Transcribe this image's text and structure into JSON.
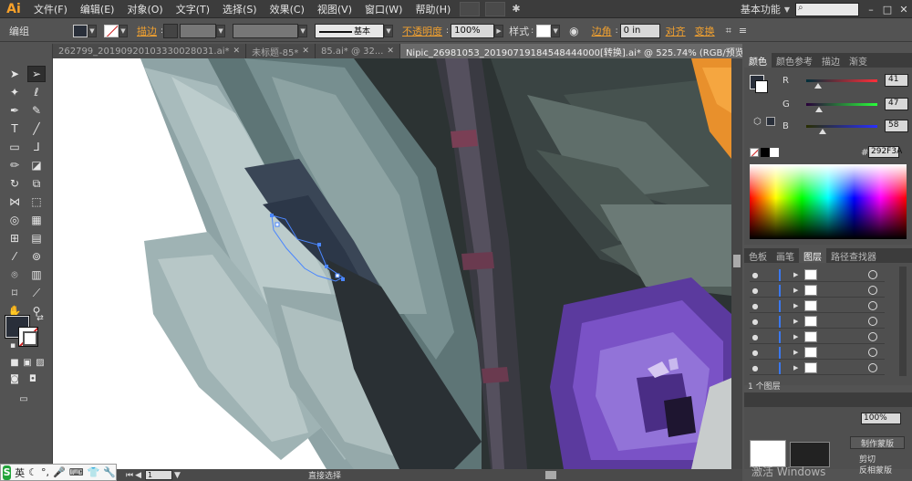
{
  "app": {
    "logo": "Ai",
    "menu": [
      "文件(F)",
      "编辑(E)",
      "对象(O)",
      "文字(T)",
      "选择(S)",
      "效果(C)",
      "视图(V)",
      "窗口(W)",
      "帮助(H)"
    ],
    "workspace": "基本功能",
    "window_buttons": [
      "–",
      "□",
      "✕"
    ]
  },
  "control_bar": {
    "group_label": "编组",
    "stroke_label": "描边",
    "stroke_style": "基本",
    "opacity_label": "不透明度",
    "opacity_value": "100%",
    "style_label": "样式",
    "corner_label": "边角",
    "corner_value": "0 in",
    "align_label": "对齐",
    "transform_label": "变换",
    "fill_color": "#292f3a"
  },
  "tabs": [
    {
      "label": "262799_20190920103330028031.ai*",
      "active": false
    },
    {
      "label": "未标题-85*",
      "active": false
    },
    {
      "label": "85.ai* @ 32...",
      "active": false
    },
    {
      "label": "Nipic_26981053_20190719184548444000[转换].ai* @ 525.74% (RGB/预览)",
      "active": true
    }
  ],
  "status_bar": {
    "page": "1",
    "mode": "直接选择"
  },
  "color_panel": {
    "tabs": [
      "颜色",
      "颜色参考",
      "描边",
      "渐变"
    ],
    "r_label": "R",
    "r_value": "41",
    "g_label": "G",
    "g_value": "47",
    "b_label": "B",
    "b_value": "58",
    "hex": "292F3A",
    "r": 41,
    "g": 47,
    "b": 58
  },
  "layers_panel": {
    "tabs": [
      "色板",
      "画笔",
      "图层",
      "路径查找器"
    ],
    "row_count": 7,
    "footer": "1 个图层"
  },
  "bottom_panel": {
    "opacity": "100%",
    "mask_button": "制作蒙版",
    "clip_label": "剪切",
    "invert_label": "反相蒙版"
  },
  "ime": {
    "logo": "S",
    "lang": "英"
  },
  "watermark": {
    "activate": "激活 Windows"
  }
}
